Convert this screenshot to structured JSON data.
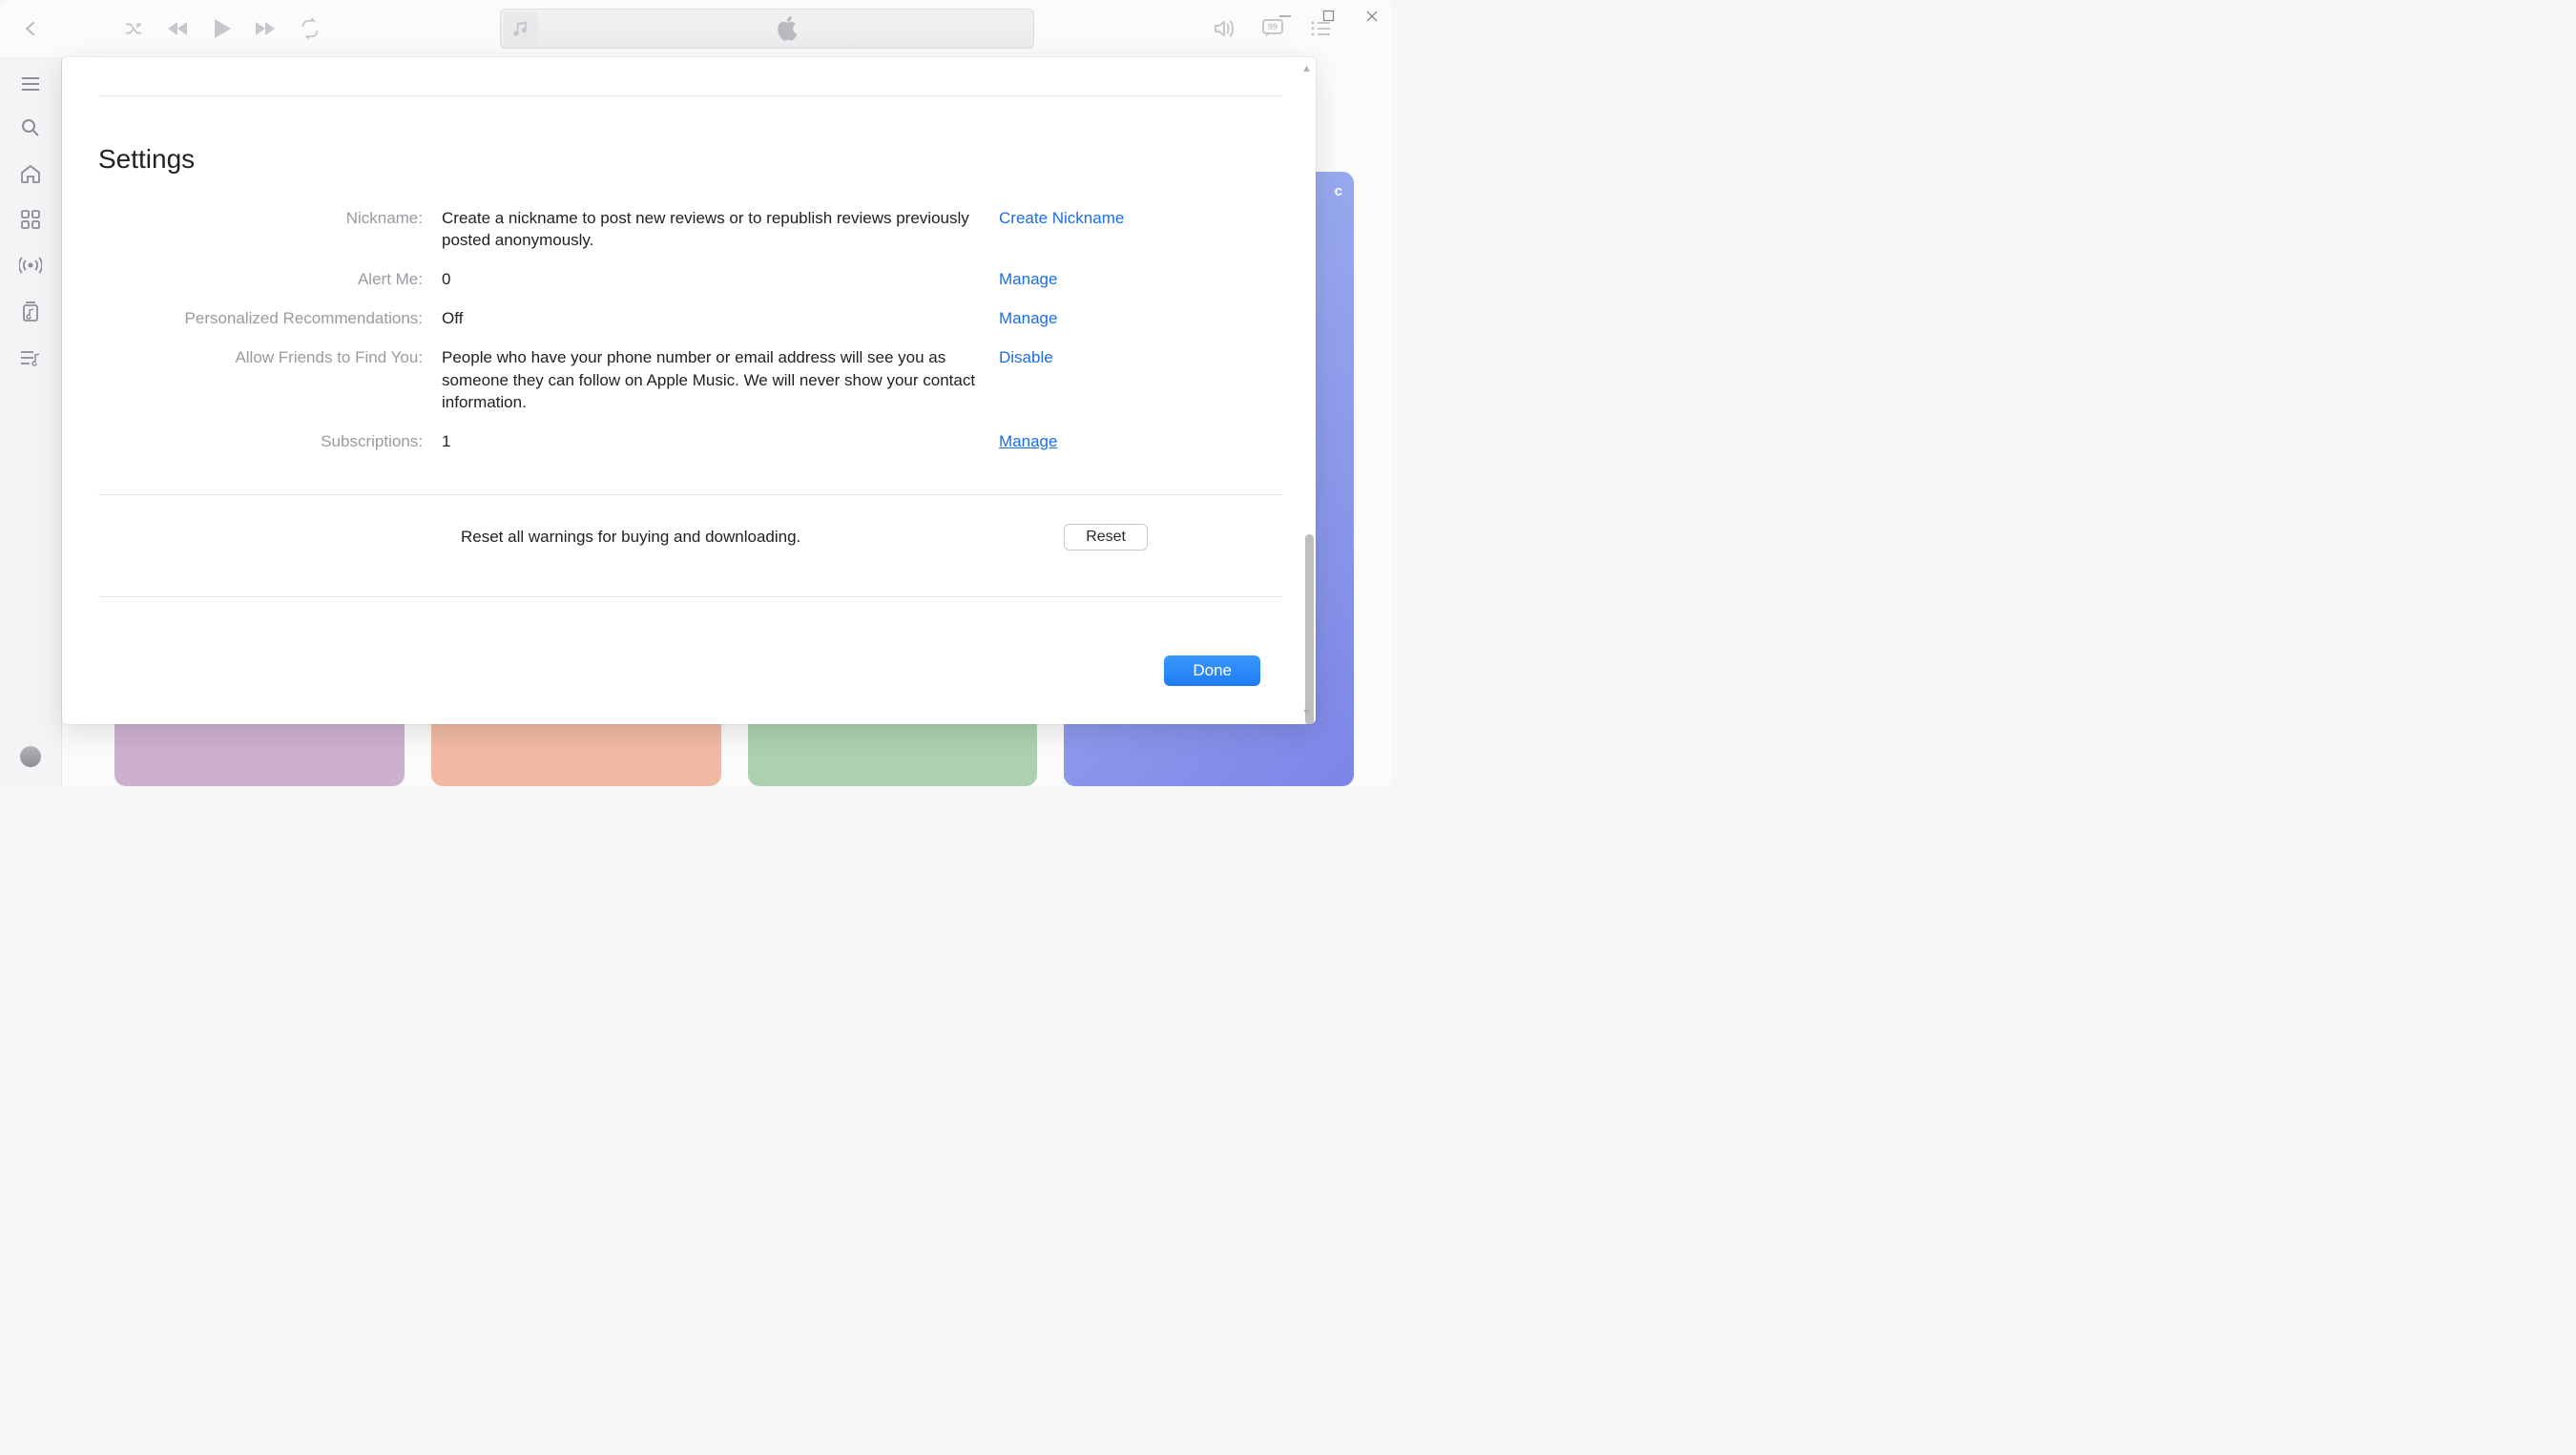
{
  "settings": {
    "heading": "Settings",
    "rows": {
      "nickname": {
        "label": "Nickname:",
        "value": "Create a nickname to post new reviews or to republish reviews previously posted anonymously.",
        "action": "Create Nickname"
      },
      "alert": {
        "label": "Alert Me:",
        "value": "0",
        "action": "Manage"
      },
      "recs": {
        "label": "Personalized Recommendations:",
        "value": "Off",
        "action": "Manage"
      },
      "friends": {
        "label": "Allow Friends to Find You:",
        "value": "People who have your phone number or email address will see you as someone they can follow on Apple Music. We will never show your contact information.",
        "action": "Disable"
      },
      "subs": {
        "label": "Subscriptions:",
        "value": "1",
        "action": "Manage"
      }
    },
    "reset_text": "Reset all warnings for buying and downloading.",
    "reset_button": "Reset",
    "done_button": "Done"
  },
  "bg_tile_letter": "c"
}
